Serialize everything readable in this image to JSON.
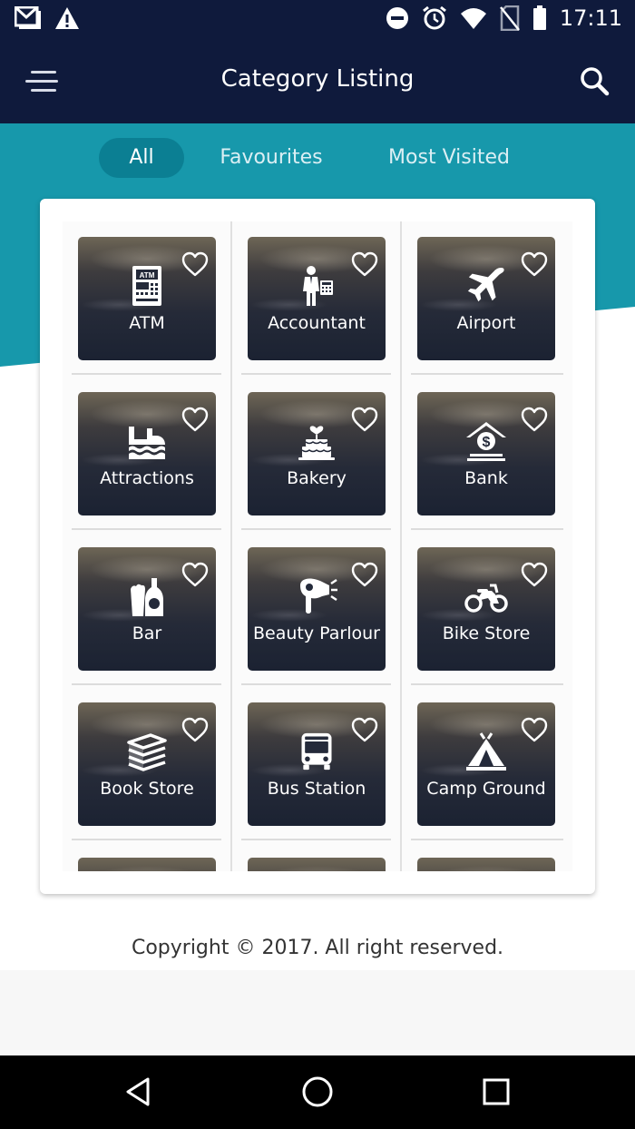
{
  "status_bar": {
    "time": "17:11",
    "left_icons": [
      "gmail-icon",
      "warning-icon"
    ],
    "right_icons": [
      "do-not-disturb-icon",
      "alarm-icon",
      "wifi-icon",
      "no-sim-icon",
      "battery-icon"
    ]
  },
  "app_bar": {
    "title": "Category Listing",
    "menu_icon": "menu-icon",
    "search_icon": "search-icon"
  },
  "tabs": [
    {
      "label": "All",
      "active": true
    },
    {
      "label": "Favourites",
      "active": false
    },
    {
      "label": "Most Visited",
      "active": false
    }
  ],
  "categories": [
    {
      "label": "ATM",
      "icon": "atm-icon"
    },
    {
      "label": "Accountant",
      "icon": "accountant-icon"
    },
    {
      "label": "Airport",
      "icon": "airplane-icon"
    },
    {
      "label": "Attractions",
      "icon": "attractions-icon"
    },
    {
      "label": "Bakery",
      "icon": "cake-icon"
    },
    {
      "label": "Bank",
      "icon": "bank-icon"
    },
    {
      "label": "Bar",
      "icon": "drinks-icon"
    },
    {
      "label": "Beauty Parlour",
      "icon": "hair-dryer-icon"
    },
    {
      "label": "Bike Store",
      "icon": "motorbike-icon"
    },
    {
      "label": "Book Store",
      "icon": "books-icon"
    },
    {
      "label": "Bus Station",
      "icon": "bus-icon"
    },
    {
      "label": "Camp Ground",
      "icon": "tent-icon"
    },
    {
      "label": "",
      "icon": ""
    },
    {
      "label": "",
      "icon": ""
    },
    {
      "label": "",
      "icon": ""
    }
  ],
  "favourite_icon": "heart-outline-icon",
  "footer": {
    "copyright": "Copyright © 2017. All right reserved."
  },
  "nav_bar": {
    "icons": [
      "back-icon",
      "home-icon",
      "recents-icon"
    ]
  },
  "colors": {
    "header_navy": "#0f1a3c",
    "accent_teal": "#1798ab",
    "active_tab": "#0b7f93"
  }
}
